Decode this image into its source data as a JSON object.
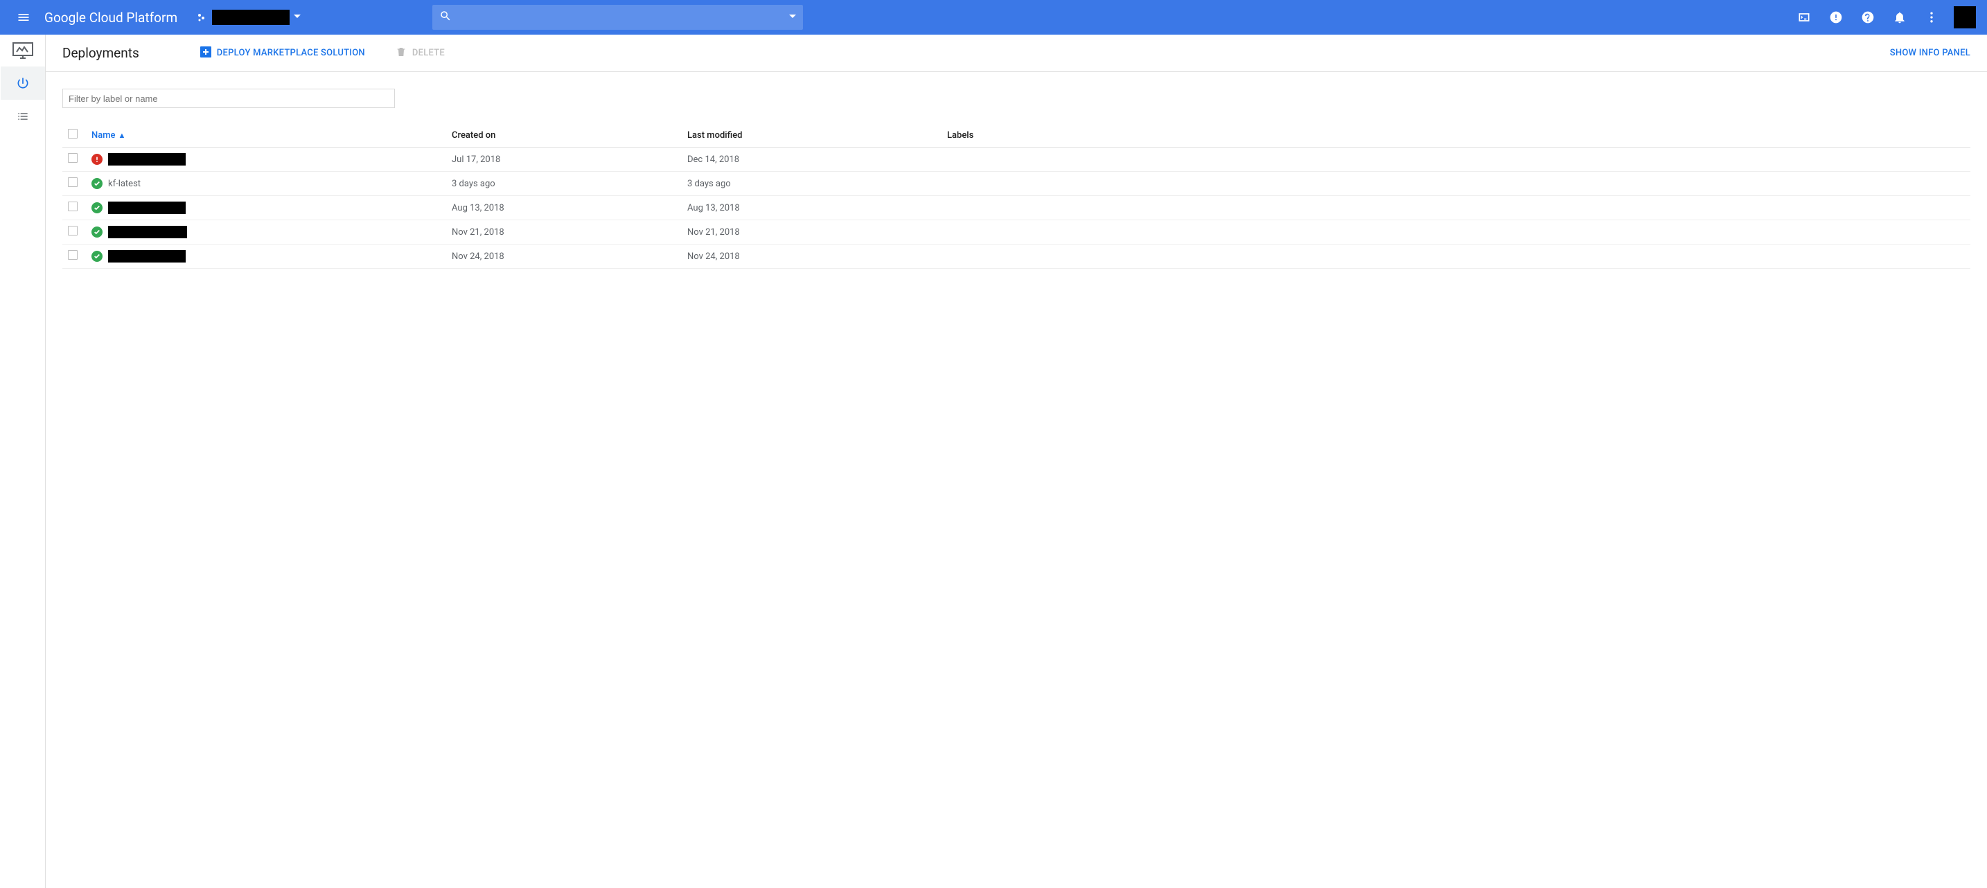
{
  "header": {
    "platform_title": "Google Cloud Platform",
    "search_placeholder": ""
  },
  "toolbar": {
    "page_title": "Deployments",
    "deploy_label": "DEPLOY MARKETPLACE SOLUTION",
    "delete_label": "DELETE",
    "show_info_label": "SHOW INFO PANEL"
  },
  "filter": {
    "placeholder": "Filter by label or name"
  },
  "table": {
    "headers": {
      "name": "Name",
      "created": "Created on",
      "modified": "Last modified",
      "labels": "Labels"
    },
    "sort_indicator": "▲",
    "rows": [
      {
        "status": "err",
        "name_redacted": true,
        "name": "",
        "redact_w": 112,
        "created": "Jul 17, 2018",
        "modified": "Dec 14, 2018"
      },
      {
        "status": "ok",
        "name_redacted": false,
        "name": "kf-latest",
        "redact_w": 0,
        "created": "3 days ago",
        "modified": "3 days ago"
      },
      {
        "status": "ok",
        "name_redacted": true,
        "name": "",
        "redact_w": 112,
        "created": "Aug 13, 2018",
        "modified": "Aug 13, 2018"
      },
      {
        "status": "ok",
        "name_redacted": true,
        "name": "",
        "redact_w": 114,
        "created": "Nov 21, 2018",
        "modified": "Nov 21, 2018"
      },
      {
        "status": "ok",
        "name_redacted": true,
        "name": "",
        "redact_w": 112,
        "created": "Nov 24, 2018",
        "modified": "Nov 24, 2018"
      }
    ]
  }
}
